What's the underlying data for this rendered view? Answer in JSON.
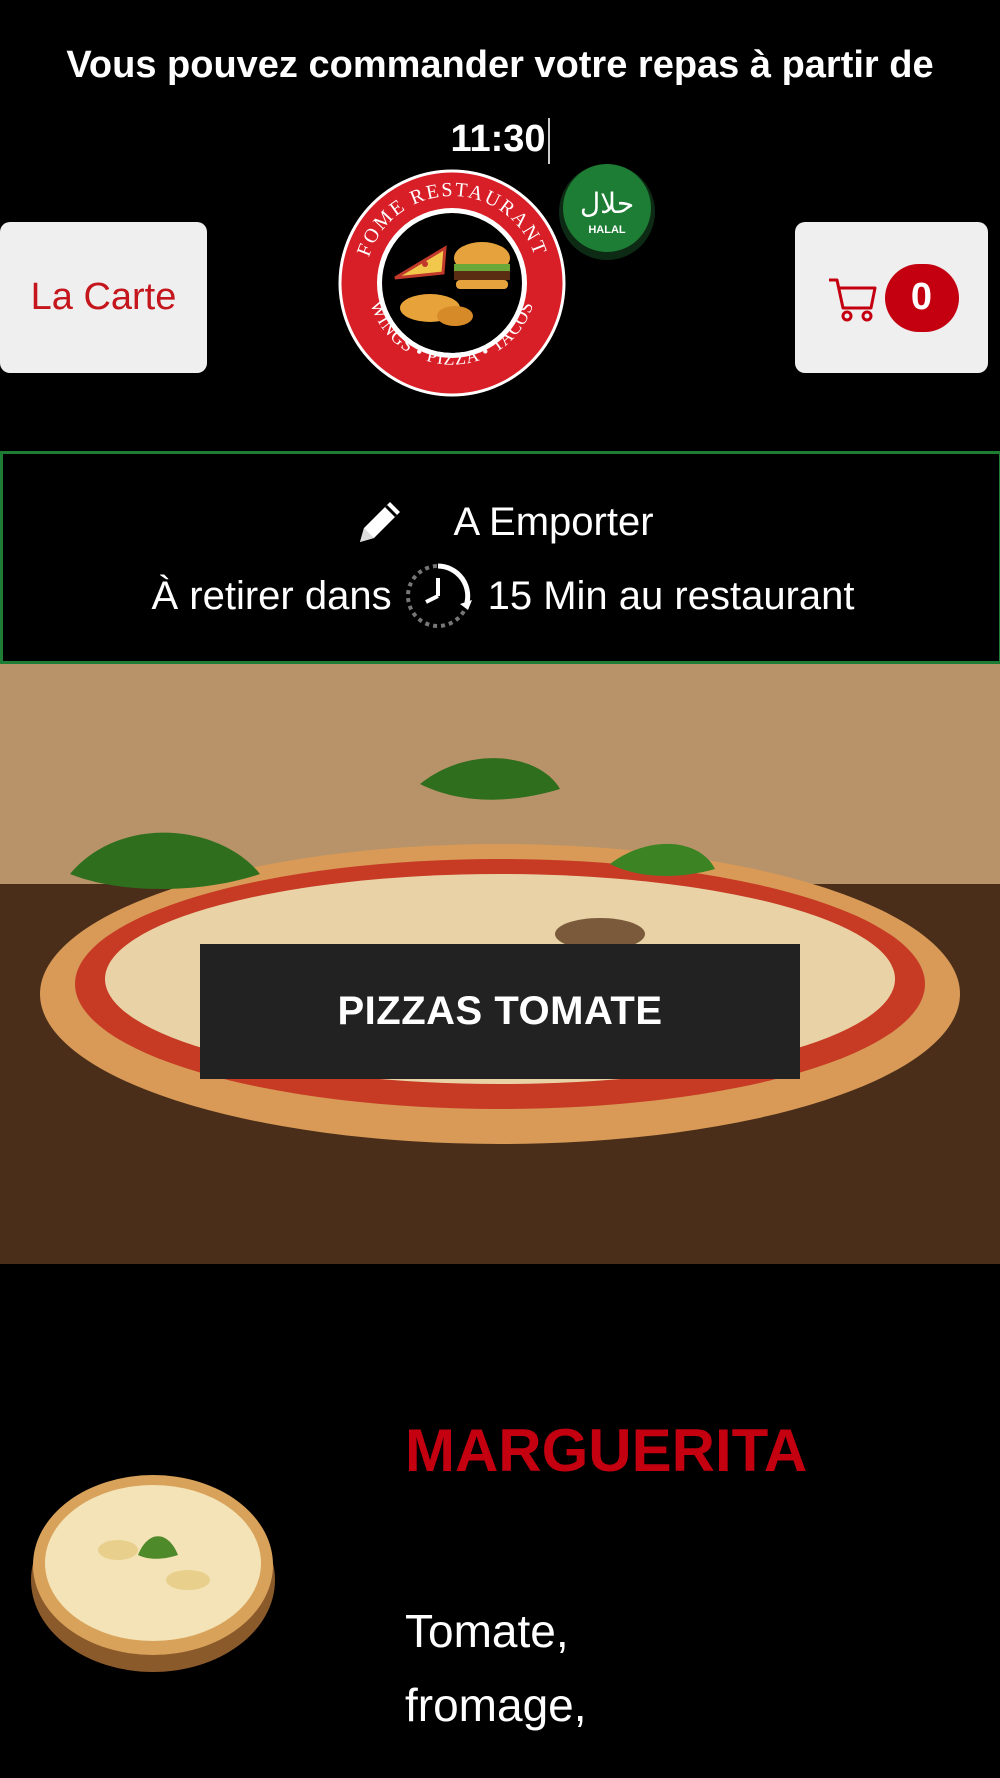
{
  "order_notice": {
    "line1": "Vous pouvez commander votre repas à partir de",
    "time": "11:30"
  },
  "header": {
    "menu_button_label": "La Carte",
    "cart_count": "0",
    "logo_top_text": "FOME RESTAURANT",
    "logo_bottom_text": "WINGS • PIZZA • TACOS",
    "halal_arabic": "حلال",
    "halal_label": "HALAL"
  },
  "takeaway": {
    "mode": "A Emporter",
    "pickup_prefix": "À retirer dans",
    "pickup_suffix": "15 Min au restaurant"
  },
  "category": {
    "title": "PIZZAS TOMATE"
  },
  "product": {
    "name": "MARGUERITA",
    "description_line1": "Tomate,",
    "description_line2": "fromage,"
  },
  "colors": {
    "accent_red": "#c40010",
    "takeaway_border": "#1e7d34",
    "button_bg": "#efefef"
  }
}
